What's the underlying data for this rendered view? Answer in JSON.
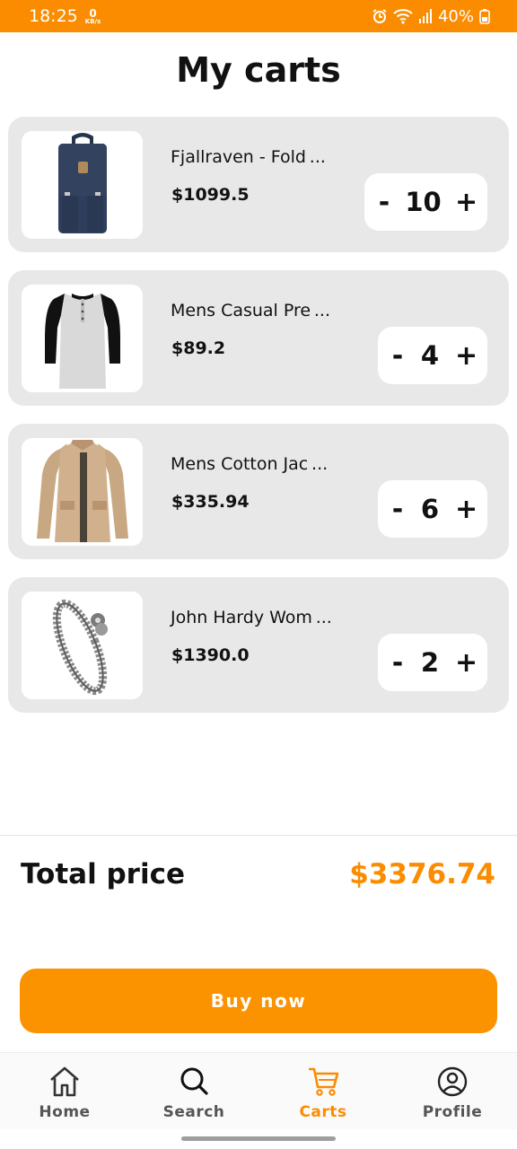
{
  "status_bar": {
    "time": "18:25",
    "net_speed": "0",
    "net_unit": "KB/s",
    "battery": "40%",
    "icons": [
      "alarm-icon",
      "wifi-icon",
      "signal-icon",
      "battery-icon"
    ]
  },
  "header": {
    "title": "My carts"
  },
  "cart": {
    "items": [
      {
        "name": "Fjallraven - Fold ...",
        "price": "$1099.5",
        "qty": "10",
        "image": "backpack-image"
      },
      {
        "name": "Mens Casual Pre ...",
        "price": "$89.2",
        "qty": "4",
        "image": "tshirt-image"
      },
      {
        "name": "Mens Cotton Jac ...",
        "price": "$335.94",
        "qty": "6",
        "image": "jacket-image"
      },
      {
        "name": "John Hardy Wom ...",
        "price": "$1390.0",
        "qty": "2",
        "image": "bracelet-image"
      }
    ],
    "minus_label": "-",
    "plus_label": "+"
  },
  "summary": {
    "total_label": "Total price",
    "total_value": "$3376.74"
  },
  "buy_button": {
    "label": "Buy now"
  },
  "nav": {
    "items": [
      {
        "label": "Home",
        "icon": "home-icon",
        "active": false
      },
      {
        "label": "Search",
        "icon": "search-icon",
        "active": false
      },
      {
        "label": "Carts",
        "icon": "cart-icon",
        "active": true
      },
      {
        "label": "Profile",
        "icon": "profile-icon",
        "active": false
      }
    ]
  },
  "colors": {
    "accent": "#fb8c00",
    "card_bg": "#e8e8e8",
    "inactive": "#555555"
  }
}
